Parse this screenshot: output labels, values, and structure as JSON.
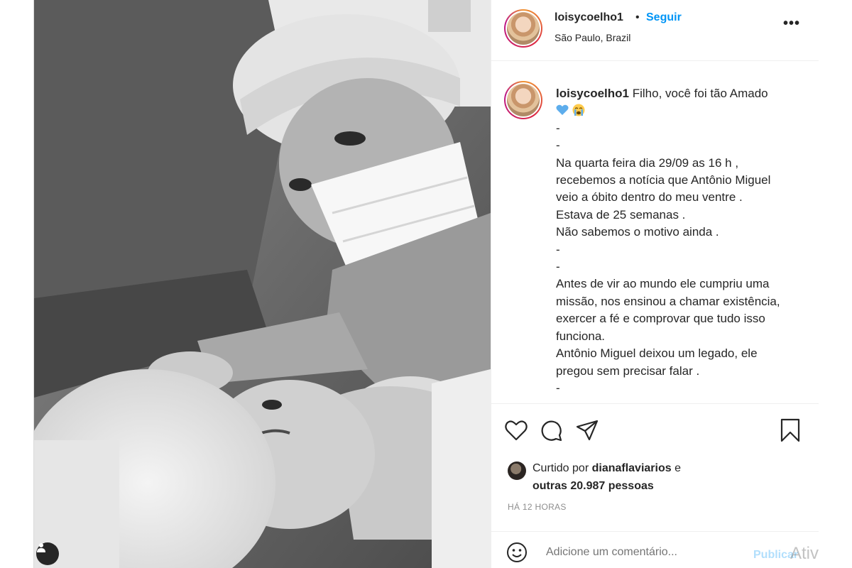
{
  "post": {
    "username": "loisycoelho1",
    "separator": "•",
    "follow_label": "Seguir",
    "location": "São Paulo, Brazil",
    "more_label": "•••"
  },
  "caption": {
    "username": "loisycoelho1",
    "first_line": "Filho, você foi tão Amado",
    "emojis": [
      "blue-heart-emoji",
      "crying-face-emoji"
    ],
    "lines": [
      "-",
      "-",
      "Na quarta feira dia 29/09 as 16 h ,",
      "recebemos a notícia que Antônio Miguel",
      "veio a óbito dentro do meu ventre .",
      "Estava de 25 semanas .",
      "Não sabemos o motivo ainda .",
      "-",
      "-",
      "Antes de vir ao mundo ele cumpriu uma",
      "missão, nos ensinou a chamar existência,",
      "exercer a fé e comprovar que tudo isso",
      "funciona.",
      "Antônio Miguel deixou um legado, ele",
      "pregou sem precisar falar .",
      "-"
    ]
  },
  "actions": {
    "icons": [
      "heart-icon",
      "comment-icon",
      "share-icon",
      "bookmark-icon"
    ]
  },
  "likes": {
    "prefix": "Curtido por ",
    "user": "dianaflaviarios",
    "connector": " e",
    "others": "outras 20.987 pessoas"
  },
  "time_ago": "HÁ 12 HORAS",
  "comment": {
    "placeholder": "Adicione um comentário...",
    "publish_label": "Publicar"
  },
  "watermark": "Ativ",
  "colors": {
    "accent": "#0095f6",
    "publish_disabled": "#b2dffc",
    "text": "#262626",
    "muted": "#8e8e8e"
  }
}
